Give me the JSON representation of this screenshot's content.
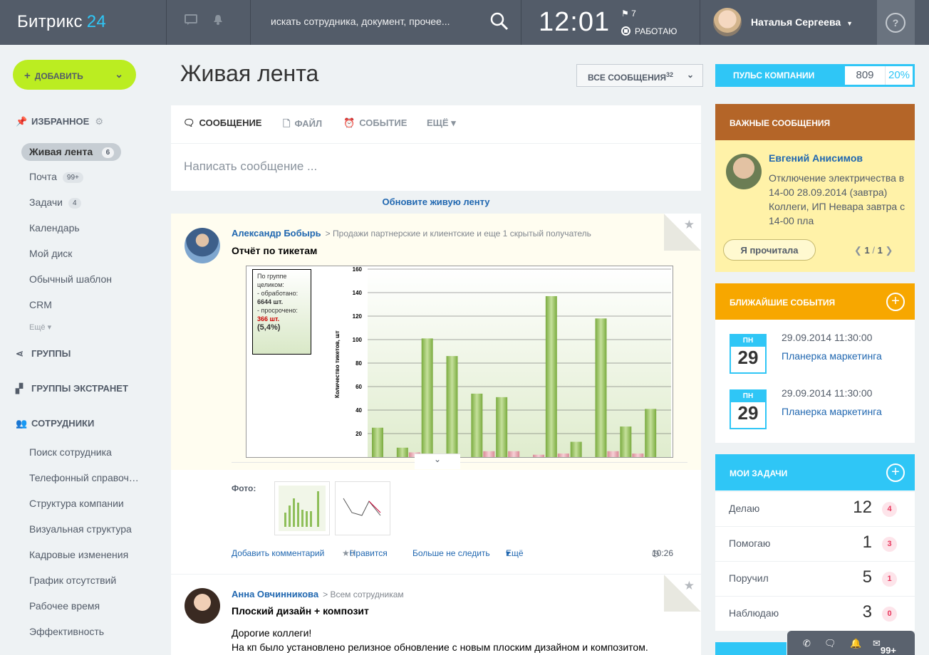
{
  "header": {
    "logo_text": "Битрикс",
    "logo_num": "24",
    "search_placeholder": "искать сотрудника, документ, прочее...",
    "clock": "12:01",
    "flag_count": "7",
    "work_status": "РАБОТАЮ",
    "user_name": "Наталья Сергеева",
    "help": "?"
  },
  "left": {
    "add_button": "ДОБАВИТЬ",
    "favorites": "ИЗБРАННОЕ",
    "items": [
      {
        "label": "Живая лента",
        "count": "6"
      },
      {
        "label": "Почта",
        "count": "99+"
      },
      {
        "label": "Задачи",
        "count": "4"
      },
      {
        "label": "Календарь"
      },
      {
        "label": "Мой диск"
      },
      {
        "label": "Обычный шаблон"
      },
      {
        "label": "CRM"
      }
    ],
    "more": "Ещё",
    "groups": "ГРУППЫ",
    "extranet": "ГРУППЫ ЭКСТРАНЕТ",
    "employees": "СОТРУДНИКИ",
    "emp_items": [
      "Поиск сотрудника",
      "Телефонный справоч…",
      "Структура компании",
      "Визуальная структура",
      "Кадровые изменения",
      "График отсутствий",
      "Рабочее время",
      "Эффективность"
    ]
  },
  "main": {
    "title": "Живая лента",
    "filter": "ВСЕ СООБЩЕНИЯ",
    "filter_count": "32",
    "tabs": [
      "СООБЩЕНИЕ",
      "ФАЙЛ",
      "СОБЫТИЕ",
      "ЕЩЁ"
    ],
    "compose_placeholder": "Написать сообщение ...",
    "refresh": "Обновите живую ленту",
    "post1": {
      "author": "Александр Бобырь",
      "dest": "Продажи партнерские и клиентские и еще 1 скрытый получатель",
      "title": "Отчёт по тикетам",
      "photo_label": "Фото:",
      "actions": {
        "comment": "Добавить комментарий",
        "likes": "0",
        "like": "Нравится",
        "unfollow": "Больше не следить",
        "more": "Ещё",
        "time": "10:26"
      }
    },
    "post2": {
      "author": "Анна Овчинникова",
      "dest": "Всем сотрудникам",
      "title": "Плоский дизайн + композит",
      "line1": "Дорогие коллеги!",
      "line2": "На кп было установлено релизное обновление с новым плоским дизайном и композитом."
    }
  },
  "chart_data": {
    "type": "bar",
    "ylabel": "Количество тикетов, шт",
    "ylim": [
      0,
      160
    ],
    "yticks": [
      "160",
      "140",
      "120",
      "100",
      "80",
      "60",
      "40",
      "20"
    ],
    "legend_lines": [
      "По группе",
      "целиком:",
      "- обработано:",
      "6644 шт.",
      "- просрочено:",
      "366 шт.",
      "(5,4%)"
    ],
    "series": [
      {
        "values": [
          25,
          8,
          101,
          86,
          54,
          51,
          0,
          137,
          13,
          118,
          26,
          41
        ]
      },
      {
        "values": [
          0,
          4,
          0,
          0,
          5,
          5,
          2,
          3,
          0,
          5,
          3,
          0
        ]
      }
    ]
  },
  "right": {
    "pulse_label": "ПУЛЬС КОМПАНИИ",
    "pulse_value": "809",
    "pulse_pct": "20%",
    "important_title": "ВАЖНЫЕ СООБЩЕНИЯ",
    "imp_author": "Евгений Анисимов",
    "imp_text": "Отключение электричества в 14-00 28.09.2014 (завтра) Коллеги, ИП Невара завтра с 14-00 пла",
    "read_btn": "Я прочитала",
    "pager_cur": "1",
    "pager_sep": "/",
    "pager_total": "1",
    "events_title": "БЛИЖАЙШИЕ СОБЫТИЯ",
    "events": [
      {
        "day": "ПН",
        "num": "29",
        "date": "29.09.2014 11:30:00",
        "name": "Планерка маркетинга"
      },
      {
        "day": "ПН",
        "num": "29",
        "date": "29.09.2014 11:30:00",
        "name": "Планерка маркетинга"
      }
    ],
    "tasks_title": "МОИ ЗАДАЧИ",
    "tasks": [
      {
        "label": "Делаю",
        "num": "12",
        "badge": "4"
      },
      {
        "label": "Помогаю",
        "num": "1",
        "badge": "3"
      },
      {
        "label": "Поручил",
        "num": "5",
        "badge": "1"
      },
      {
        "label": "Наблюдаю",
        "num": "3",
        "badge": "0"
      }
    ],
    "notif_count": "99+"
  }
}
